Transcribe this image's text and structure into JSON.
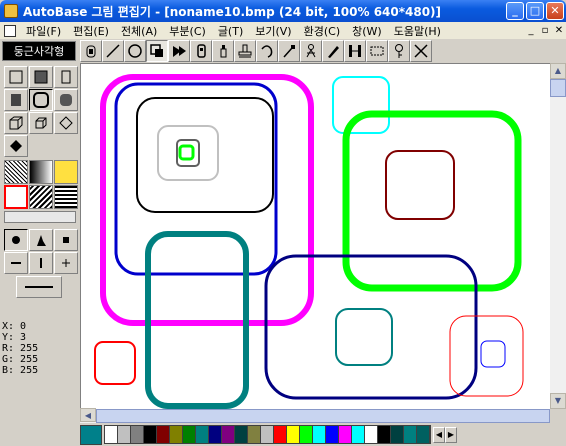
{
  "window": {
    "title": "AutoBase 그림 편집기 - [noname10.bmp (24 bit, 100% 640*480)]"
  },
  "menu": [
    "파일(F)",
    "편집(E)",
    "전체(A)",
    "부분(C)",
    "글(T)",
    "보기(V)",
    "환경(C)",
    "창(W)",
    "도움말(H)"
  ],
  "toolbar": {
    "shape_name": "둥근사각형",
    "tools": [
      "spray-icon",
      "line-icon",
      "ellipse-icon",
      "rect-select-icon",
      "fill-icon",
      "phone-icon",
      "bottle-icon",
      "stamp-icon",
      "curve-icon",
      "dropper-icon",
      "figure-icon",
      "pen-brush-icon",
      "resize-icon",
      "rect-outline-icon",
      "key-icon",
      "close-x-icon"
    ]
  },
  "readout": {
    "x": "X: 0",
    "y": "Y: 3",
    "r": "R: 255",
    "g": "G: 255",
    "b": "B: 255"
  },
  "colors": {
    "current": "#00808a",
    "swatches": [
      "#ffffff",
      "#c0c0c0",
      "#808080",
      "#000000",
      "#800000",
      "#808000",
      "#008000",
      "#008080",
      "#000080",
      "#800080",
      "#004040",
      "#808040",
      "#c0c0c0",
      "#ff0000",
      "#ffff00",
      "#00ff00",
      "#00ffff",
      "#0000ff",
      "#ff00ff",
      "#00ffff",
      "#ffffff",
      "#000000",
      "#004040",
      "#008080",
      "#006060"
    ]
  },
  "shapes": [
    {
      "color": "#ff00ff"
    },
    {
      "color": "#0000cc"
    },
    {
      "color": "#000000"
    },
    {
      "color": "#c0c0c0"
    },
    {
      "color": "#606060"
    },
    {
      "color": "#00ff00"
    },
    {
      "color": "#00ffff"
    },
    {
      "color": "#00ff00"
    },
    {
      "color": "#800000"
    },
    {
      "color": "#008080"
    },
    {
      "color": "#000080"
    },
    {
      "color": "#008080"
    },
    {
      "color": "#ff0000"
    },
    {
      "color": "#ff0000"
    },
    {
      "color": "#0000ff"
    }
  ]
}
